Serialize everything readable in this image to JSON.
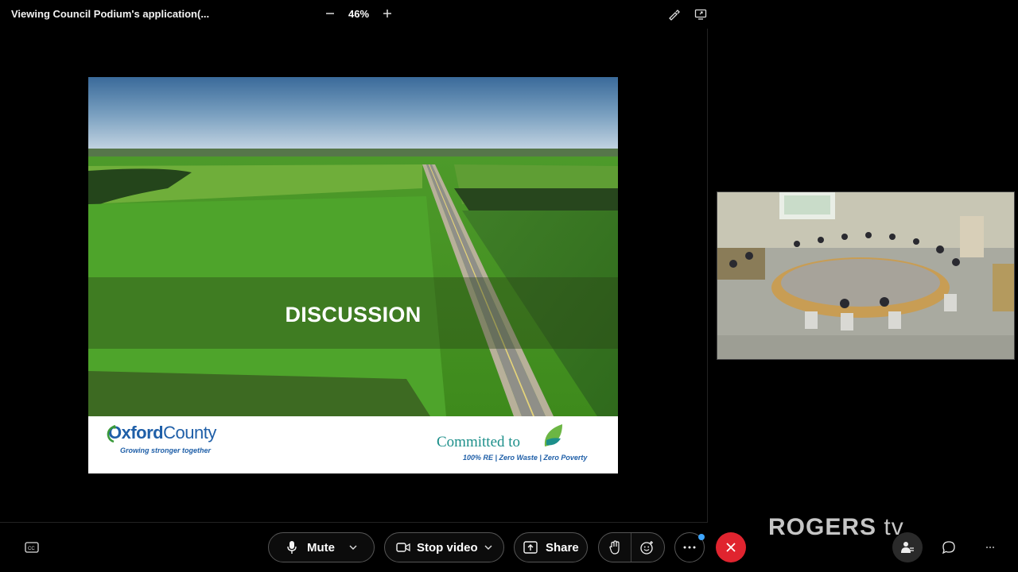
{
  "header": {
    "share_title": "Viewing Council Podium's application(...",
    "zoom_level": "46%"
  },
  "slide": {
    "heading": "DISCUSSION",
    "logo_left": {
      "name_part1": "Oxford",
      "name_part2": "County",
      "tagline": "Growing stronger together"
    },
    "logo_right": {
      "title": "Committed to",
      "subtitle": "100% RE  |  Zero Waste  |  Zero Poverty"
    }
  },
  "toolbar": {
    "mute_label": "Mute",
    "stop_video_label": "Stop video",
    "share_label": "Share"
  },
  "watermark": {
    "brand": "ROGERS",
    "suffix": "tv"
  },
  "colors": {
    "end_call": "#e0242f",
    "accent": "#3ea6ff"
  }
}
